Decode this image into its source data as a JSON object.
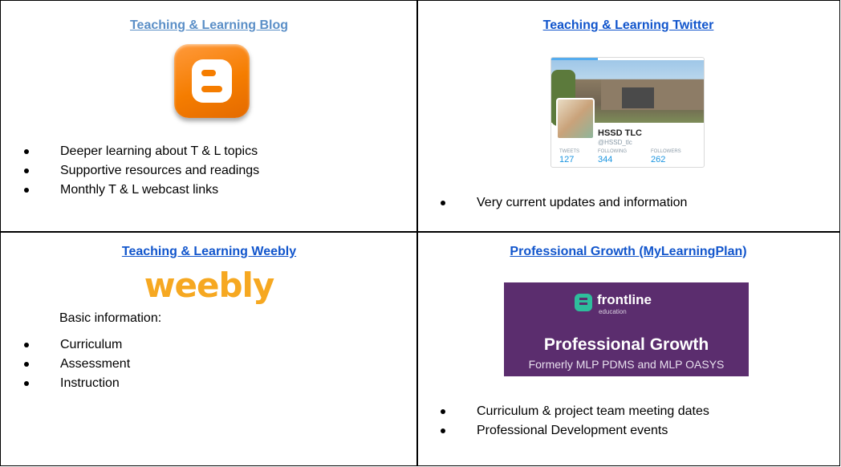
{
  "cells": {
    "blog": {
      "title": "Teaching & Learning Blog",
      "logo_icon": "blogger-logo-icon",
      "bullets": [
        "Deeper learning about T & L topics",
        "Supportive resources and readings",
        "Monthly T & L webcast links"
      ]
    },
    "twitter": {
      "title": "Teaching & Learning Twitter",
      "profile": {
        "name": "HSSD TLC",
        "handle": "@HSSD_tlc",
        "stats": [
          {
            "label": "TWEETS",
            "value": "127"
          },
          {
            "label": "FOLLOWING",
            "value": "344"
          },
          {
            "label": "FOLLOWERS",
            "value": "262"
          }
        ]
      },
      "bullets": [
        "Very current updates and information"
      ]
    },
    "weebly": {
      "title": "Teaching & Learning Weebly",
      "logo_text": "weebly",
      "intro": "Basic information:",
      "bullets": [
        "Curriculum",
        "Assessment",
        "Instruction"
      ]
    },
    "growth": {
      "title": "Professional Growth (MyLearningPlan)",
      "banner": {
        "brand": "frontline",
        "brand_sub": "education",
        "heading": "Professional Growth",
        "subheading": "Formerly MLP PDMS and MLP OASYS",
        "background": "#5b2d6e"
      },
      "bullets": [
        "Curriculum & project team meeting dates",
        "Professional Development events"
      ]
    }
  },
  "colors": {
    "link_blog": "#5b8fc7",
    "link": "#1155cc",
    "blogger_orange": "#f57d00",
    "weebly_orange": "#f6a821",
    "twitter_blue": "#1b95e0"
  }
}
